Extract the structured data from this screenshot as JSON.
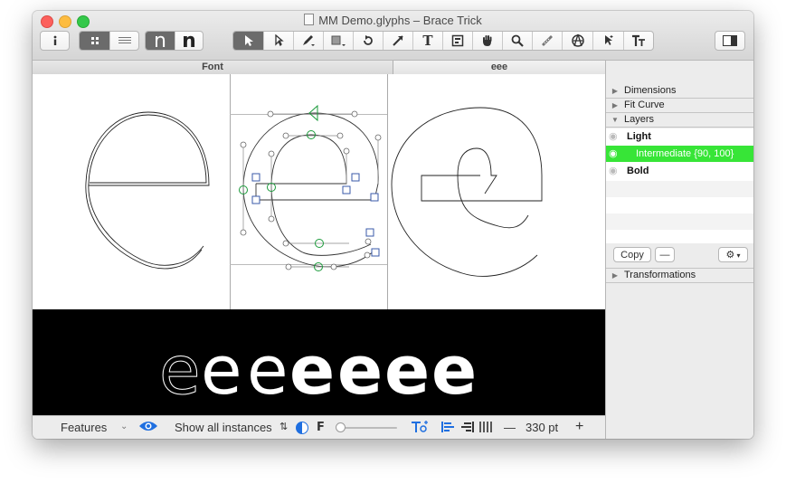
{
  "window": {
    "title": "MM Demo.glyphs – Brace Trick"
  },
  "toolbar": {
    "info_icon": "info-icon",
    "grid_view_icon": "grid-view-icon",
    "list_view_icon": "list-view-icon",
    "glyph_light_label": "n",
    "glyph_bold_label": "n",
    "tools": [
      "select-arrow-icon",
      "select-all-layers-icon",
      "draw-pen-icon",
      "primitives-rectangle-icon",
      "rotate-icon",
      "scale-icon",
      "text-tool-icon",
      "annotation-icon",
      "hand-icon",
      "zoom-icon",
      "measure-ruler-icon",
      "knife-compass-icon",
      "select-cursor-icon",
      "type-text-icon"
    ],
    "text_tool_label": "T",
    "sidebar_toggle_icon": "sidebar-toggle-icon"
  },
  "tabs": [
    {
      "label": "Font"
    },
    {
      "label": "eee"
    }
  ],
  "preview": {
    "glyph_string": "eeeeeee"
  },
  "bottom_bar": {
    "features_label": "Features",
    "instances_label": "Show all instances",
    "font_letter": "F",
    "size_label": "330 pt",
    "minus_label": "—",
    "plus_label": "+"
  },
  "panel": {
    "dimensions_label": "Dimensions",
    "fit_curve_label": "Fit Curve",
    "layers_label": "Layers",
    "layers": [
      {
        "name": "Light",
        "selected": false
      },
      {
        "name": "Intermediate {90, 100}",
        "selected": true
      },
      {
        "name": "Bold",
        "selected": false
      }
    ],
    "copy_label": "Copy",
    "remove_label": "—",
    "transformations_label": "Transformations"
  },
  "colors": {
    "selection_green": "#37e537",
    "preview_bg": "#000000",
    "accent_blue": "#1f6fe0"
  }
}
